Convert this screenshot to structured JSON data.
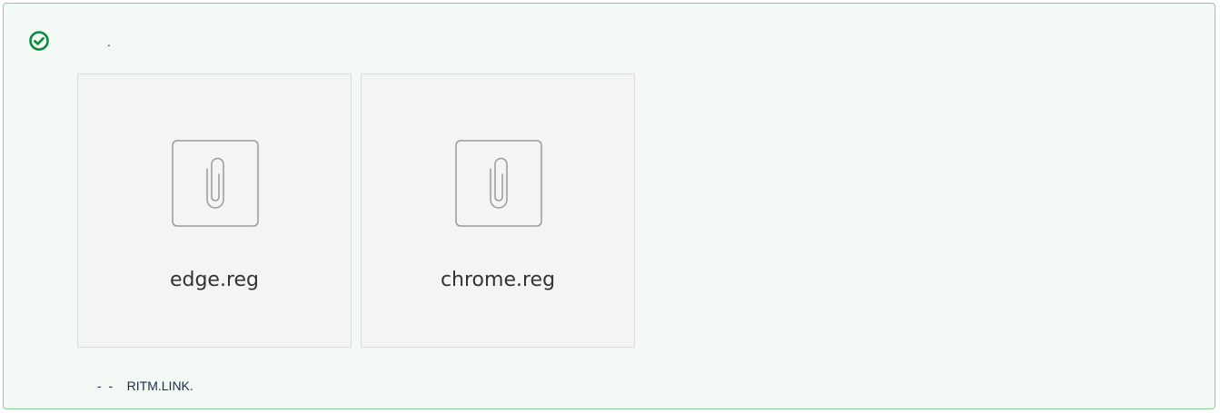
{
  "panel": {
    "status": "success",
    "header_text": ".",
    "footer_text": "-  -    RITM.LINK."
  },
  "attachments": [
    {
      "name": "edge.reg",
      "icon": "paperclip-icon"
    },
    {
      "name": "chrome.reg",
      "icon": "paperclip-icon"
    }
  ],
  "colors": {
    "success_green": "#0a8a3a",
    "panel_border": "#8fcc97",
    "panel_background": "#f3f9f4",
    "card_background": "#f4f4f4"
  }
}
